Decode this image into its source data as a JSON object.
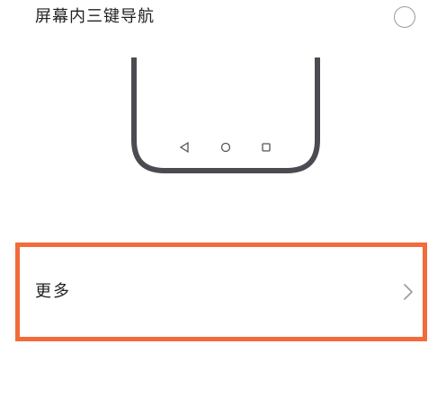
{
  "option": {
    "label": "屏幕内三键导航",
    "selected": false
  },
  "preview": {
    "nav_keys": [
      "back-icon",
      "home-icon",
      "recents-icon"
    ],
    "frame_color": "#4b4b52"
  },
  "more_row": {
    "label": "更多",
    "chevron": "chevron-right-icon"
  },
  "highlight": {
    "color": "#f26b3a"
  }
}
